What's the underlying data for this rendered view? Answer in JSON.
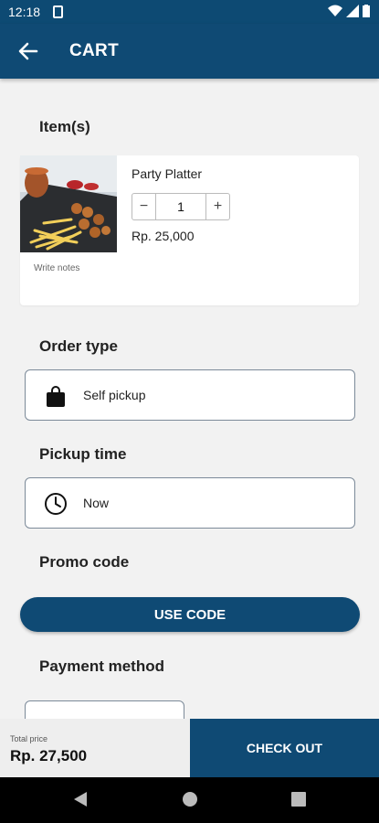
{
  "status_bar": {
    "time": "12:18"
  },
  "app_bar": {
    "title": "CART"
  },
  "sections": {
    "items": "Item(s)",
    "order_type": "Order type",
    "pickup_time": "Pickup time",
    "promo_code": "Promo code",
    "payment_method": "Payment method"
  },
  "cart_items": [
    {
      "name": "Party Platter",
      "quantity": "1",
      "price": "Rp. 25,000",
      "notes_label": "Write notes",
      "image_icon": "food-photo"
    }
  ],
  "order_type": {
    "value": "Self pickup",
    "icon": "shopping-bag-icon"
  },
  "pickup_time": {
    "value": "Now",
    "icon": "clock-icon"
  },
  "promo": {
    "button_label": "USE CODE"
  },
  "bottom": {
    "total_label": "Total price",
    "total_value": "Rp. 27,500",
    "checkout_label": "CHECK OUT"
  },
  "colors": {
    "primary": "#0f4a74",
    "background": "#f2f2f2"
  }
}
